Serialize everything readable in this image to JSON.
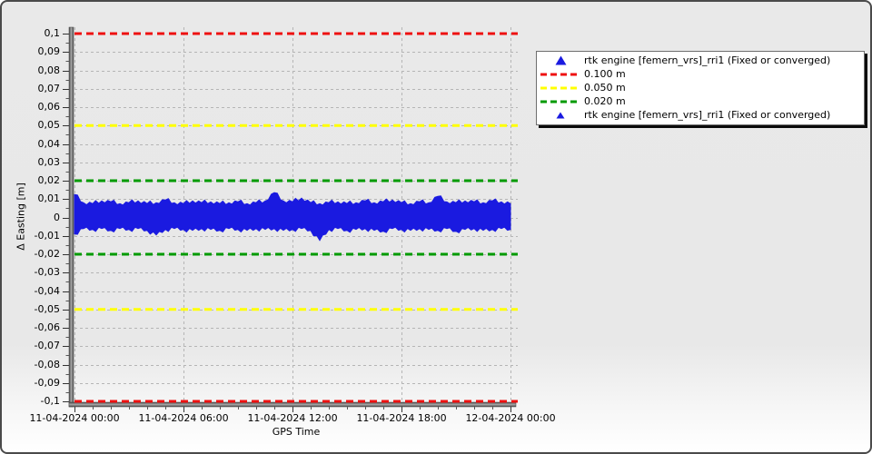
{
  "panel": {
    "background_top": "#e9e9e9",
    "background_bottom": "#ffffff",
    "border_color": "#4a4a4a",
    "grid_color": "#b5b5b5",
    "axis_bar_color": "#555555"
  },
  "chart_data": {
    "type": "scatter",
    "title": "",
    "xlabel": "GPS Time",
    "ylabel": "Δ Easting [m]",
    "ylim": [
      -0.1,
      0.1
    ],
    "y_tick_step": 0.01,
    "decimal_separator_axis": ",",
    "y_tick_labels": [
      "0,1",
      "0,09",
      "0,08",
      "0,07",
      "0,06",
      "0,05",
      "0,04",
      "0,03",
      "0,02",
      "0,01",
      "0",
      "-0,01",
      "-0,02",
      "-0,03",
      "-0,04",
      "-0,05",
      "-0,06",
      "-0,07",
      "-0,08",
      "-0,09",
      "-0,1"
    ],
    "xlim_hours": [
      0,
      24
    ],
    "x_major_step_hours": 6,
    "x_tick_labels": [
      "11-04-2024 00:00",
      "11-04-2024 06:00",
      "11-04-2024 12:00",
      "11-04-2024 18:00",
      "12-04-2024 00:00"
    ],
    "grid": {
      "enabled": true,
      "style": "dashed",
      "color": "#b5b5b5"
    },
    "thresholds": [
      {
        "label": "0.100 m",
        "value_m": 0.1,
        "applies": "plus-minus",
        "color": "#ee1111",
        "style": "dashed",
        "width": 3
      },
      {
        "label": "0.050 m",
        "value_m": 0.05,
        "applies": "plus-minus",
        "color": "#ffff00",
        "style": "dashed",
        "width": 3
      },
      {
        "label": "0.020 m",
        "value_m": 0.02,
        "applies": "plus-minus",
        "color": "#009a00",
        "style": "dashed",
        "width": 3
      }
    ],
    "series": [
      {
        "name": "rtk engine [femern_vrs]_rri1 (Fixed or converged)",
        "marker": "triangle",
        "color": "#1a1ae0",
        "description": "dense noise band of fixed/converged RTK epochs centred on 0 m",
        "band_envelope": {
          "x_hours_step": 0.5,
          "top_m": [
            0.0125,
            0.008,
            0.0075,
            0.009,
            0.0085,
            0.0075,
            0.008,
            0.009,
            0.0075,
            0.008,
            0.0095,
            0.008,
            0.0075,
            0.009,
            0.008,
            0.0085,
            0.0075,
            0.008,
            0.0085,
            0.0075,
            0.008,
            0.009,
            0.0135,
            0.009,
            0.0085,
            0.0105,
            0.008,
            0.0075,
            0.008,
            0.0085,
            0.0075,
            0.008,
            0.009,
            0.008,
            0.0085,
            0.0095,
            0.008,
            0.0075,
            0.0085,
            0.008,
            0.0115,
            0.0085,
            0.008,
            0.009,
            0.0085,
            0.008,
            0.009,
            0.0085,
            0.0075
          ],
          "bottom_m": [
            -0.009,
            -0.006,
            -0.0065,
            -0.006,
            -0.007,
            -0.006,
            -0.0065,
            -0.006,
            -0.007,
            -0.0095,
            -0.0065,
            -0.006,
            -0.0065,
            -0.007,
            -0.006,
            -0.0065,
            -0.007,
            -0.006,
            -0.0065,
            -0.007,
            -0.006,
            -0.0065,
            -0.006,
            -0.007,
            -0.0065,
            -0.006,
            -0.007,
            -0.0125,
            -0.0065,
            -0.006,
            -0.007,
            -0.0065,
            -0.006,
            -0.007,
            -0.0075,
            -0.006,
            -0.0065,
            -0.007,
            -0.006,
            -0.0065,
            -0.007,
            -0.006,
            -0.0075,
            -0.0065,
            -0.006,
            -0.007,
            -0.0065,
            -0.006,
            -0.0065
          ]
        }
      }
    ],
    "legend": {
      "position": "top-right",
      "entries": [
        {
          "type": "marker",
          "marker": "triangle",
          "color": "#1a1ae0",
          "size": 11,
          "label": "rtk engine [femern_vrs]_rri1 (Fixed or converged)"
        },
        {
          "type": "dash",
          "color": "#ee1111",
          "label": "0.100 m"
        },
        {
          "type": "dash",
          "color": "#ffff00",
          "label": "0.050 m"
        },
        {
          "type": "dash",
          "color": "#009a00",
          "label": "0.020 m"
        },
        {
          "type": "marker",
          "marker": "triangle",
          "color": "#1a1ae0",
          "size": 8,
          "label": "rtk engine [femern_vrs]_rri1 (Fixed or converged)"
        }
      ]
    }
  }
}
